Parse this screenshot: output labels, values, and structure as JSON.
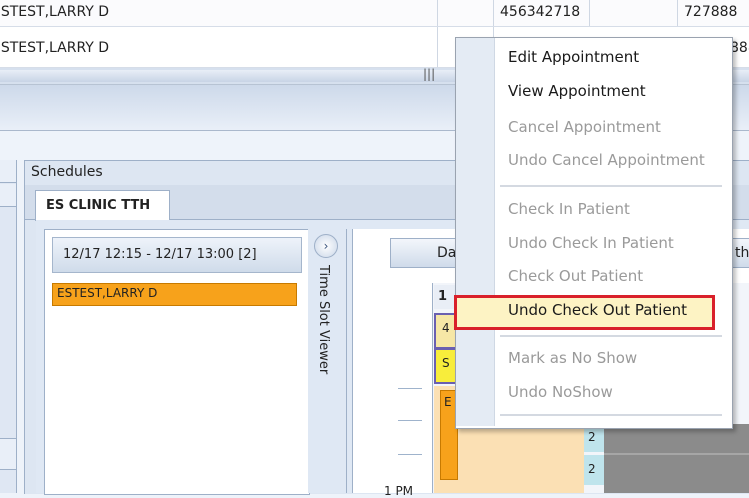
{
  "grid": {
    "rows": [
      {
        "name": "ESTEST,LARRY D",
        "id": "456342718",
        "extra": "727888"
      },
      {
        "name": "ESTEST,LARRY D",
        "id": "",
        "extra": "888"
      }
    ]
  },
  "schedules": {
    "title": "Schedules",
    "tab": "ES CLINIC TTH",
    "slot_header": "12/17 12:15 - 12/17 13:00  [2]",
    "slot_patient": "ESTEST,LARRY D",
    "time_slot_viewer": "Time Slot Viewer",
    "day_btn": "Da",
    "month_btn": "th",
    "time_label": "1 PM",
    "cal_header_num": "1",
    "cal_row_label_1": "4",
    "cal_row_label_2": "S",
    "cal_block_label": "E",
    "count_1": "2",
    "count_2": "2"
  },
  "context_menu": {
    "items": [
      {
        "label": "Edit Appointment",
        "enabled": true
      },
      {
        "label": "View Appointment",
        "enabled": true
      },
      {
        "label": "Cancel Appointment",
        "enabled": false
      },
      {
        "label": "Undo Cancel Appointment",
        "enabled": false
      },
      {
        "label": "Check In Patient",
        "enabled": false
      },
      {
        "label": "Undo Check In Patient",
        "enabled": false
      },
      {
        "label": "Check Out Patient",
        "enabled": false
      },
      {
        "label": "Undo Check Out Patient",
        "enabled": true,
        "highlighted": true
      },
      {
        "label": "Mark as No Show",
        "enabled": false
      },
      {
        "label": "Undo NoShow",
        "enabled": false
      }
    ]
  },
  "colors": {
    "highlight_border": "#d9202a",
    "highlight_fill": "#fdf3c4",
    "patient_orange": "#f7a21b",
    "calendar_peach": "#fbe0b4",
    "count_teal": "#bfe4ec"
  }
}
